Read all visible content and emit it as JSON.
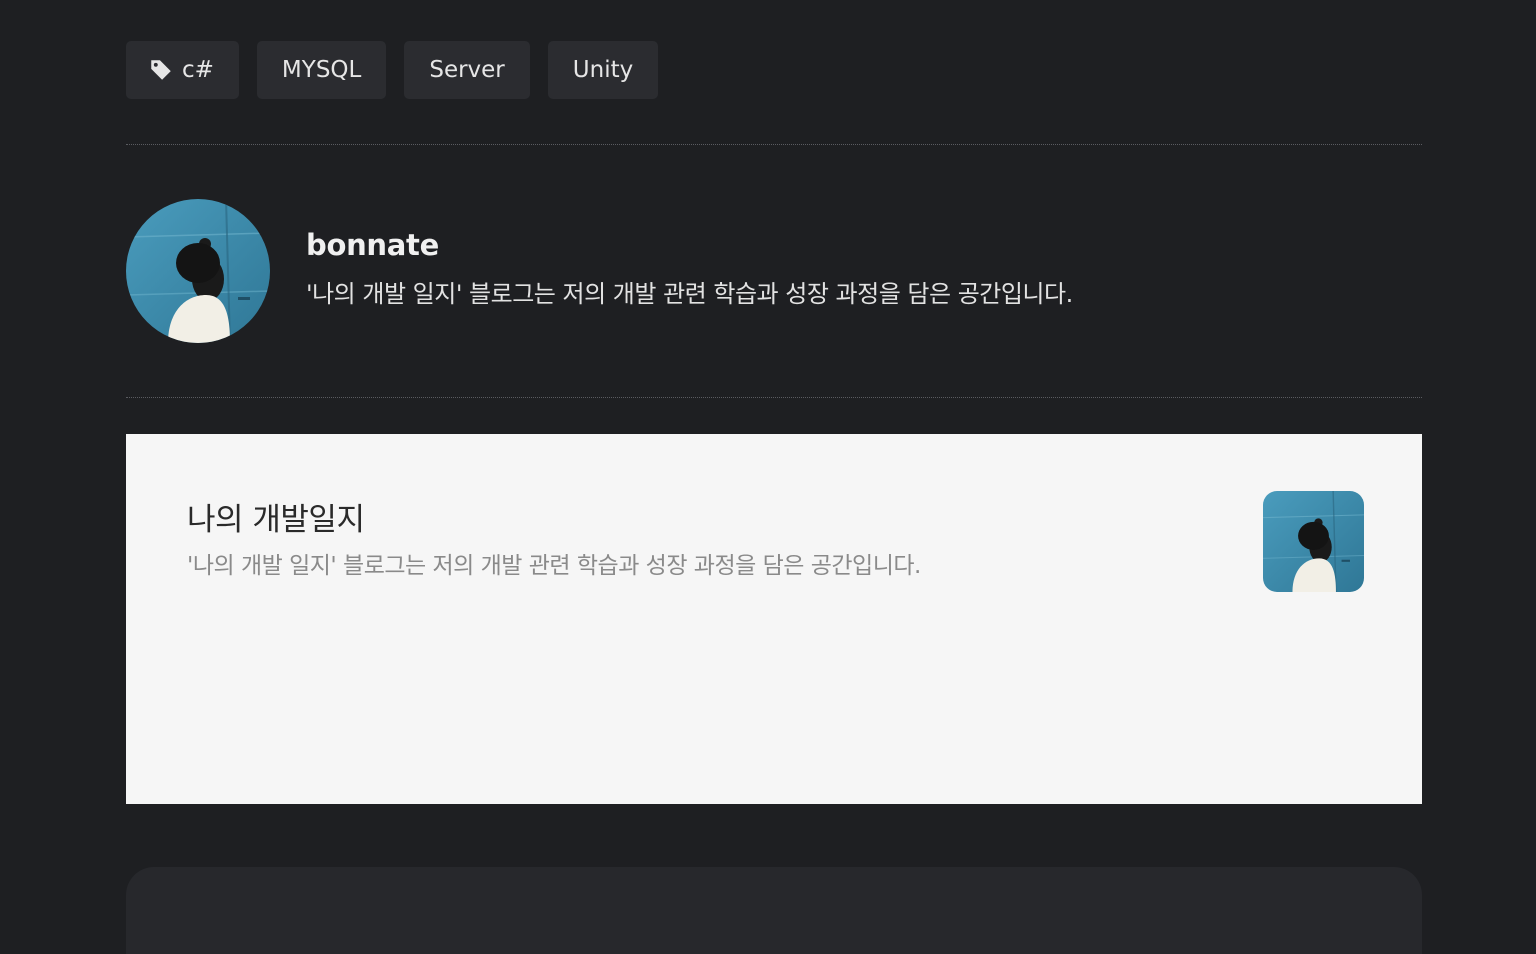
{
  "tags": [
    {
      "label": "c#",
      "icon": "tag-icon"
    },
    {
      "label": "MYSQL"
    },
    {
      "label": "Server"
    },
    {
      "label": "Unity"
    }
  ],
  "author": {
    "name": "bonnate",
    "description": "'나의 개발 일지' 블로그는 저의 개발 관련 학습과 성장 과정을 담은 공간입니다."
  },
  "blog_card": {
    "title": "나의 개발일지",
    "description": "'나의 개발 일지' 블로그는 저의 개발 관련 학습과 성장 과정을 담은 공간입니다."
  },
  "colors": {
    "background": "#1e1f22",
    "tag_bg": "#2b2c30",
    "card_bg": "#f6f6f6",
    "avatar_bg": "#3f8fb0"
  }
}
